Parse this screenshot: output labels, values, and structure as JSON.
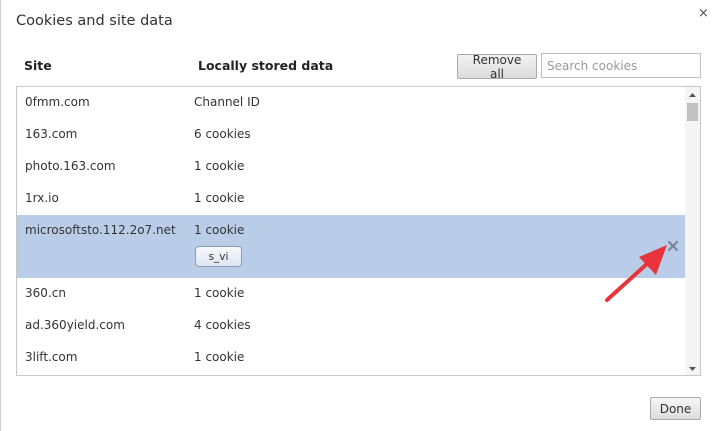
{
  "dialog": {
    "title": "Cookies and site data",
    "close_glyph": "×"
  },
  "header": {
    "site_label": "Site",
    "data_label": "Locally stored data",
    "remove_all_label": "Remove all",
    "search_placeholder": "Search cookies",
    "search_value": ""
  },
  "rows": [
    {
      "site": "0fmm.com",
      "data": "Channel ID"
    },
    {
      "site": "163.com",
      "data": "6 cookies"
    },
    {
      "site": "photo.163.com",
      "data": "1 cookie"
    },
    {
      "site": "1rx.io",
      "data": "1 cookie"
    },
    {
      "site": "microsoftsto.112.2o7.net",
      "data": "1 cookie",
      "selected": true,
      "chip": "s_vi"
    },
    {
      "site": "360.cn",
      "data": "1 cookie"
    },
    {
      "site": "ad.360yield.com",
      "data": "4 cookies"
    },
    {
      "site": "3lift.com",
      "data": "1 cookie"
    }
  ],
  "footer": {
    "done_label": "Done"
  },
  "icons": {
    "close": "close-icon",
    "row_remove": "remove-x-icon",
    "annotation": "red-arrow-annotation",
    "scroll_up": "scroll-up-arrow-icon",
    "scroll_down": "scroll-down-arrow-icon"
  },
  "colors": {
    "selected_row": "#b9cde9",
    "annotation_arrow": "#e8343a",
    "remove_x": "#7a8699"
  }
}
